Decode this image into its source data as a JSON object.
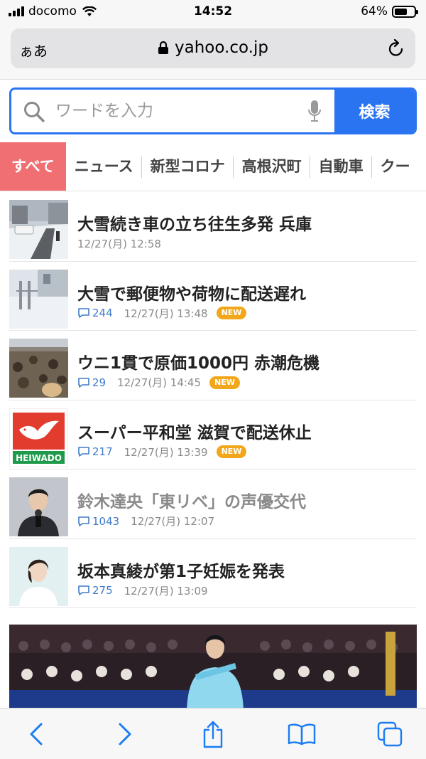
{
  "status_bar": {
    "carrier": "docomo",
    "time": "14:52",
    "battery_text": "64%",
    "battery_level": 0.64
  },
  "url_bar": {
    "text_size_label": "ぁあ",
    "url": "yahoo.co.jp"
  },
  "search": {
    "placeholder": "ワードを入力",
    "button_label": "検索",
    "accent_color": "#2a74f2"
  },
  "tabs": [
    {
      "label": "すべて",
      "active": true
    },
    {
      "label": "ニュース"
    },
    {
      "label": "新型コロナ"
    },
    {
      "label": "高根沢町"
    },
    {
      "label": "自動車"
    },
    {
      "label": "クー"
    }
  ],
  "news": [
    {
      "title": "大雪続き車の立ち往生多発 兵庫",
      "date": "12/27(月) 12:58",
      "comments": null,
      "new": false,
      "read": false
    },
    {
      "title": "大雪で郵便物や荷物に配送遅れ",
      "date": "12/27(月) 13:48",
      "comments": "244",
      "new": true,
      "read": false
    },
    {
      "title": "ウニ1貫で原価1000円 赤潮危機",
      "date": "12/27(月) 14:45",
      "comments": "29",
      "new": true,
      "read": false
    },
    {
      "title": "スーパー平和堂 滋賀で配送休止",
      "date": "12/27(月) 13:39",
      "comments": "217",
      "new": true,
      "read": false
    },
    {
      "title": "鈴木達央「東リベ」の声優交代",
      "date": "12/27(月) 12:07",
      "comments": "1043",
      "new": false,
      "read": true
    },
    {
      "title": "坂本真綾が第1子妊娠を発表",
      "date": "12/27(月) 13:09",
      "comments": "275",
      "new": false,
      "read": false
    }
  ],
  "new_badge_label": "NEW",
  "heiwado_logo_text": "HEIWADO",
  "colors": {
    "active_tab": "#ef6f72",
    "comment_link": "#3f7bc8",
    "new_badge": "#f2a71b",
    "toolbar_icon": "#1a7cf5"
  },
  "toolbar_icons": [
    "back-icon",
    "forward-icon",
    "share-icon",
    "bookmarks-icon",
    "tabs-icon"
  ]
}
